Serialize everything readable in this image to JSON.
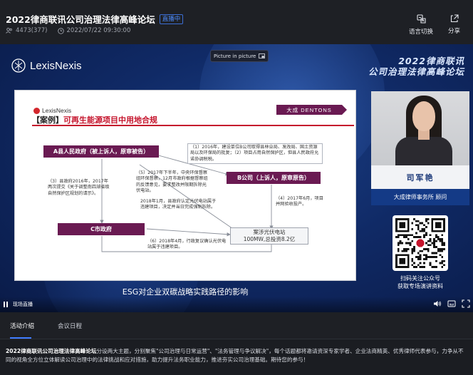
{
  "header": {
    "title": "2022律商联讯公司治理法律高峰论坛",
    "status_badge": "直播中",
    "viewers": "4473(377)",
    "datetime": "2022/07/22 09:30:00",
    "language_label": "语言切换",
    "share_label": "分享"
  },
  "player": {
    "brand": "LexisNexis",
    "pip_label": "Picture in picture",
    "forum_title_line1": "2022律商联讯",
    "forum_title_line2": "公司治理法律高峰论坛",
    "caption": "ESG对企业双碳战略实践路径的影响",
    "live_label": "现场直播"
  },
  "slide": {
    "brand": "LexisNexis",
    "heading_bracket": "【案例】",
    "heading_text": "可再生能源项目中用地合规",
    "dentons": "大成 DENTONS",
    "box_a": "A县人民政府（被上诉人，原审被告）",
    "box_b": "B公司（上诉人，原审原告）",
    "box_c": "C市政府",
    "plant_line1": "案涉光伏电站",
    "plant_line2": "100MW,总投资8.2亿",
    "note1": "（1）2016年，建设单位B公司取得县林业局、发改局、国土资源局以及环保局的批复；（2）项目占用自然保护区，但县人民政府允诺协调税税。",
    "note2": "（3）县政府2016年，2017年两次提交《关于调整南四湖省级自然保护区规划的请示》。",
    "note3": "（5）2017年下半年，中央环保督察组环保督察，12月市政府根据督察组的反馈意见，要求整改并限期拆除光伏电站。",
    "note4": "2018年1月，县政府认定光伏电站属于违建项目，决定并当日完成强制拆除。",
    "note5": "（4）2017年6月，项目并网验收投产。",
    "note6": "（6）2018年4月，行政复议确认光伏电站属于违建项目。"
  },
  "presenter": {
    "name": "司军艳",
    "title": "大成律师事务所 顾问",
    "qr_caption_line1": "扫码关注公众号",
    "qr_caption_line2": "获取专场演讲资料"
  },
  "tabs": [
    {
      "label": "活动介绍"
    },
    {
      "label": "会议日程"
    }
  ],
  "description": {
    "bold": "2022律商联讯公司治理法律高峰论坛",
    "text": "分设两大主题，分别聚焦\"公司治理与日常运营\"、\"法务管理与争议解决\"，每个话题都将邀请资深专家学者、企业法商精英、优秀律师代表参与，力争从不同的视角全方位立体解读公司治理中的法律挑战和应对措施，助力提升法务职业能力，推进夯实公司治理基础。期待您的参与！"
  },
  "colors": {
    "accent": "#3f7cff",
    "slide_purple": "#6a1a52",
    "slide_red": "#c5142c",
    "player_bg": "#102a66"
  }
}
